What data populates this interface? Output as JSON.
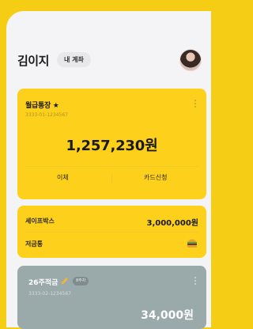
{
  "header": {
    "user_name": "김이지",
    "my_account_label": "내 계좌"
  },
  "main_account": {
    "title": "월급통장 ★",
    "account_number": "3333-01-1234567",
    "balance": "1,257,230원",
    "actions": [
      "이체",
      "카드신청"
    ]
  },
  "safe_box": {
    "label": "세이프박스",
    "amount": "3,000,000원"
  },
  "piggy": {
    "label": "저금통"
  },
  "savings": {
    "title": "26주적금",
    "badge": "8주차",
    "account_number": "3333-02-1234567",
    "amount_partial": "34,000원"
  },
  "colors": {
    "accent": "#fdd01b",
    "savings_card": "#9aa9a9"
  }
}
